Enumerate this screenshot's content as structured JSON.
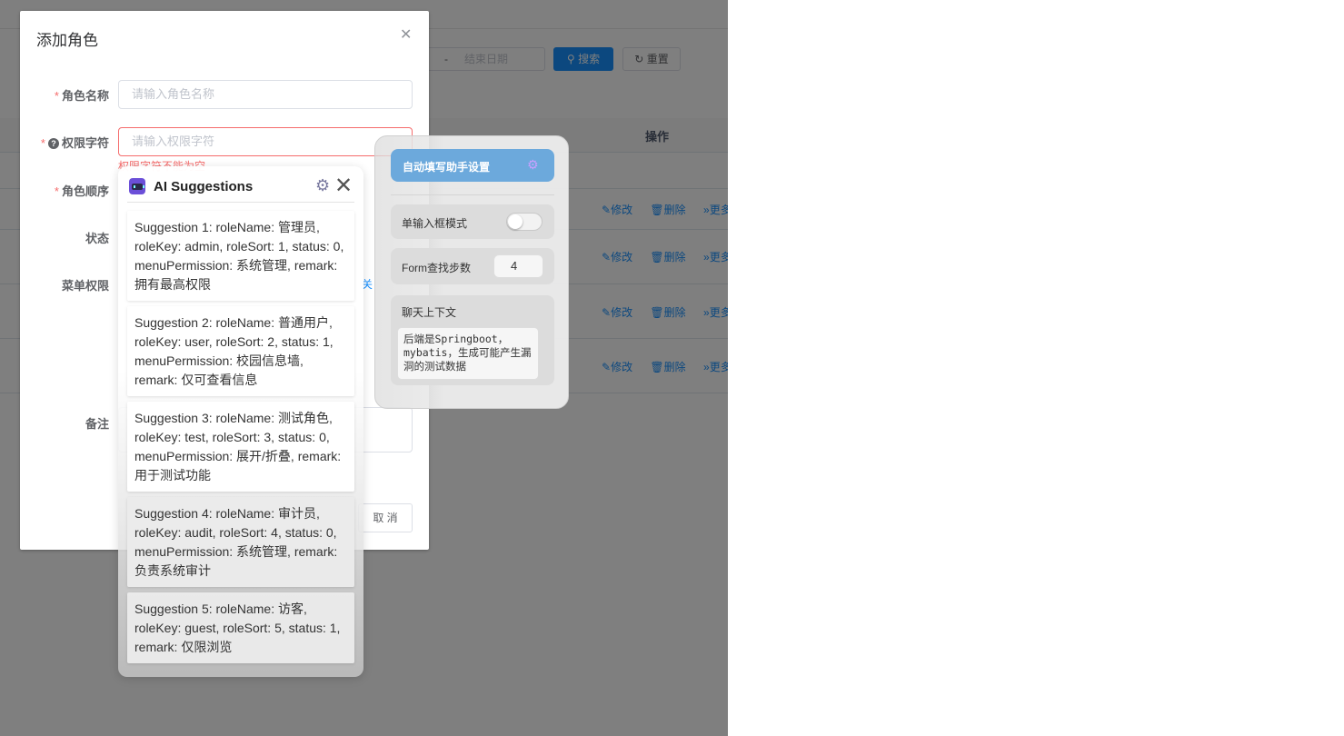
{
  "background": {
    "date_end_placeholder": "结束日期",
    "date_separator": "-",
    "search_button": "搜索",
    "reset_button": "重置",
    "ops_header": "操作",
    "row_actions": {
      "edit": "修改",
      "delete": "删除",
      "more": "更多"
    },
    "accent_color": "#1890ff"
  },
  "dialog": {
    "title": "添加角色",
    "close_icon": "close-icon",
    "fields": {
      "role_name": {
        "label": "角色名称",
        "placeholder": "请输入角色名称"
      },
      "role_key": {
        "label": "权限字符",
        "placeholder": "请输入权限字符",
        "error": "权限字符不能为空"
      },
      "role_sort": {
        "label": "角色顺序"
      },
      "status": {
        "label": "状态"
      },
      "menu_permission": {
        "label": "菜单权限",
        "partial_link": "关"
      },
      "remark": {
        "label": "备注"
      }
    },
    "cancel_button": "取 消"
  },
  "ai_suggestions": {
    "title": "AI Suggestions",
    "items": [
      "Suggestion 1: roleName: 管理员, roleKey: admin, roleSort: 1, status: 0, menuPermission: 系统管理, remark: 拥有最高权限",
      "Suggestion 2: roleName: 普通用户, roleKey: user, roleSort: 2, status: 1, menuPermission: 校园信息墙, remark: 仅可查看信息",
      "Suggestion 3: roleName: 测试角色, roleKey: test, roleSort: 3, status: 0, menuPermission: 展开/折叠, remark: 用于测试功能",
      "Suggestion 4: roleName: 审计员, roleKey: audit, roleSort: 4, status: 0, menuPermission: 系统管理, remark: 负责系统审计",
      "Suggestion 5: roleName: 访客, roleKey: guest, roleSort: 5, status: 1, remark: 仅限浏览"
    ]
  },
  "settings": {
    "header": "自动填写助手设置",
    "single_input_mode_label": "单输入框模式",
    "single_input_mode_on": false,
    "form_steps_label": "Form查找步数",
    "form_steps_value": "4",
    "chat_context_label": "聊天上下文",
    "chat_context_value": "后端是Springboot，mybatis，生成可能产生漏洞的测试数据",
    "header_color": "#6ca9dc"
  }
}
